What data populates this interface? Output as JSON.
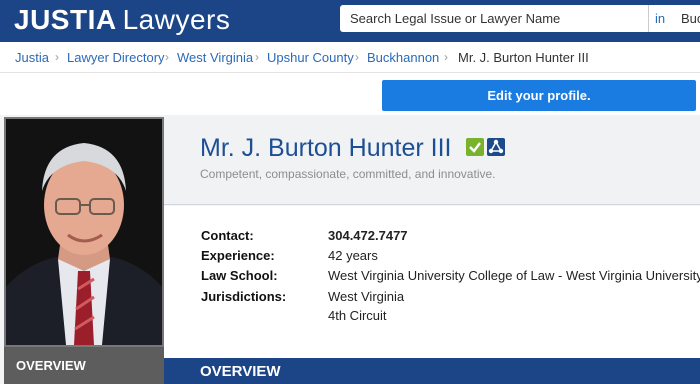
{
  "header": {
    "brand": "JUSTIA",
    "brand_sub": "Lawyers",
    "search_placeholder": "Search Legal Issue or Lawyer Name",
    "search_in": "in",
    "search_location": "Buc"
  },
  "breadcrumb": {
    "items": [
      "Justia",
      "Lawyer Directory",
      "West Virginia",
      "Upshur County",
      "Buckhannon"
    ],
    "current": "Mr. J. Burton Hunter III"
  },
  "profile": {
    "edit_label": "Edit your profile.",
    "name": "Mr. J. Burton Hunter III",
    "tagline": "Competent, compassionate, committed, and innovative.",
    "verified_icon": "check-badge-icon",
    "network_icon": "network-badge-icon",
    "accent_color": "#1d4f95",
    "verified_color": "#79b32c"
  },
  "details": {
    "contact_label": "Contact:",
    "contact_value": "304.472.7477",
    "experience_label": "Experience:",
    "experience_value": "42 years",
    "school_label": "Law School:",
    "school_value": "West Virginia University College of Law - West Virginia University",
    "jurisdictions_label": "Jurisdictions:",
    "jurisdictions": [
      "West Virginia",
      "4th Circuit"
    ]
  },
  "tabs": {
    "overview_left": "OVERVIEW",
    "overview_main": "OVERVIEW"
  }
}
